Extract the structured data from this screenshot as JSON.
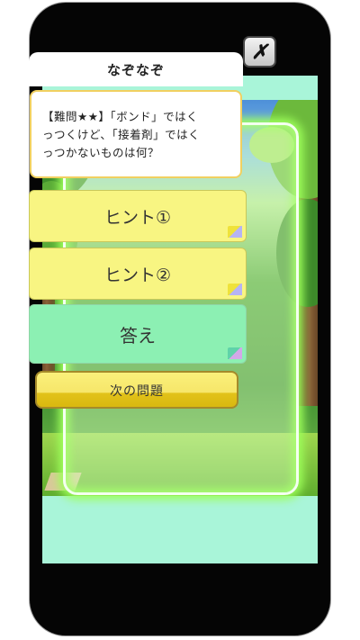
{
  "dialog": {
    "title": "なぞなぞ",
    "close_label": "✗",
    "question_lines": [
      "【難問★★】「ボンド」ではく",
      "っつくけど、「接着剤」ではく",
      "っつかないものは何？"
    ]
  },
  "buttons": {
    "hint1": "ヒント①",
    "hint2": "ヒント②",
    "answer": "答え",
    "next": "次の問題"
  },
  "colors": {
    "screen_bg": "#a9f5d9",
    "hint_bg": "#f8f582",
    "answer_bg": "#8cf0b3",
    "next_bg": "#f6e66a",
    "panel_glow": "#9dff5a"
  }
}
